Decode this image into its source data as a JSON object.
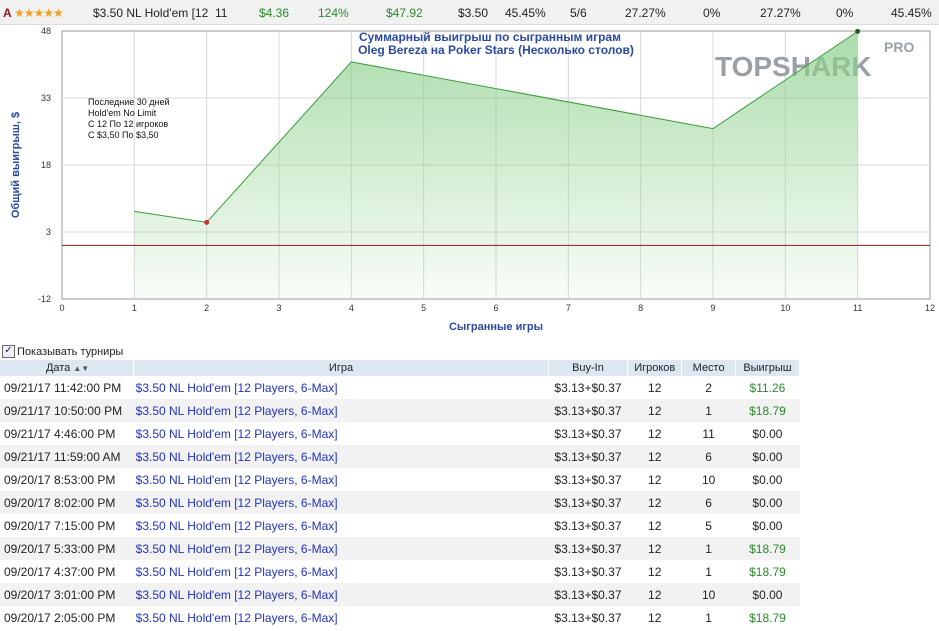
{
  "summary": {
    "grade": "A",
    "stars": "★★★★★",
    "game": "$3.50 NL Hold'em [12",
    "cols": [
      "11",
      "$4.36",
      "124%",
      "$47.92",
      "$3.50",
      "45.45%",
      "5/6",
      "27.27%",
      "0%",
      "27.27%",
      "0%",
      "45.45%"
    ]
  },
  "chart": {
    "title_line1": "Суммарный выигрыш по сыгранным играм",
    "title_line2": "Oleg Bereza на Poker Stars (Несколько столов)",
    "xlabel": "Сыгранные игры",
    "ylabel": "Общий выигрыш, $",
    "notes": [
      "Последние 30 дней",
      "Hold'em No Limit",
      "С 12 По 12 игроков",
      "С $3,50 По $3,50"
    ],
    "logo_main": "TOPSHARK",
    "logo_pro": "PRO"
  },
  "chart_data": {
    "type": "area",
    "xlim": [
      0,
      12
    ],
    "ylim": [
      -12,
      48
    ],
    "xticks": [
      0,
      1,
      2,
      3,
      4,
      5,
      6,
      7,
      8,
      9,
      10,
      11,
      12
    ],
    "yticks": [
      -12,
      3,
      18,
      33,
      48
    ],
    "x": [
      1,
      2,
      4,
      9,
      11
    ],
    "y": [
      7.63,
      5.16,
      41.08,
      26.14,
      47.92
    ],
    "reference_line": 0,
    "colors": {
      "line": "#3a9a3a",
      "fill": "#8fd18f",
      "reference": "#8b1a1a",
      "low_marker": "#d03030"
    },
    "grid": true
  },
  "toggle": {
    "label": "Показывать турниры",
    "checked": true
  },
  "table": {
    "headers": [
      "Дата",
      "Игра",
      "Buy-In",
      "Игроков",
      "Место",
      "Выигрыш"
    ],
    "rows": [
      [
        "09/21/17 11:42:00 PM",
        "$3.50 NL Hold'em [12 Players, 6-Max]",
        "$3.13+$0.37",
        "12",
        "2",
        "$11.26"
      ],
      [
        "09/21/17 10:50:00 PM",
        "$3.50 NL Hold'em [12 Players, 6-Max]",
        "$3.13+$0.37",
        "12",
        "1",
        "$18.79"
      ],
      [
        "09/21/17 4:46:00 PM",
        "$3.50 NL Hold'em [12 Players, 6-Max]",
        "$3.13+$0.37",
        "12",
        "11",
        "$0.00"
      ],
      [
        "09/21/17 11:59:00 AM",
        "$3.50 NL Hold'em [12 Players, 6-Max]",
        "$3.13+$0.37",
        "12",
        "6",
        "$0.00"
      ],
      [
        "09/20/17 8:53:00 PM",
        "$3.50 NL Hold'em [12 Players, 6-Max]",
        "$3.13+$0.37",
        "12",
        "10",
        "$0.00"
      ],
      [
        "09/20/17 8:02:00 PM",
        "$3.50 NL Hold'em [12 Players, 6-Max]",
        "$3.13+$0.37",
        "12",
        "6",
        "$0.00"
      ],
      [
        "09/20/17 7:15:00 PM",
        "$3.50 NL Hold'em [12 Players, 6-Max]",
        "$3.13+$0.37",
        "12",
        "5",
        "$0.00"
      ],
      [
        "09/20/17 5:33:00 PM",
        "$3.50 NL Hold'em [12 Players, 6-Max]",
        "$3.13+$0.37",
        "12",
        "1",
        "$18.79"
      ],
      [
        "09/20/17 4:37:00 PM",
        "$3.50 NL Hold'em [12 Players, 6-Max]",
        "$3.13+$0.37",
        "12",
        "1",
        "$18.79"
      ],
      [
        "09/20/17 3:01:00 PM",
        "$3.50 NL Hold'em [12 Players, 6-Max]",
        "$3.13+$0.37",
        "12",
        "10",
        "$0.00"
      ],
      [
        "09/20/17 2:05:00 PM",
        "$3.50 NL Hold'em [12 Players, 6-Max]",
        "$3.13+$0.37",
        "12",
        "1",
        "$18.79"
      ]
    ]
  }
}
